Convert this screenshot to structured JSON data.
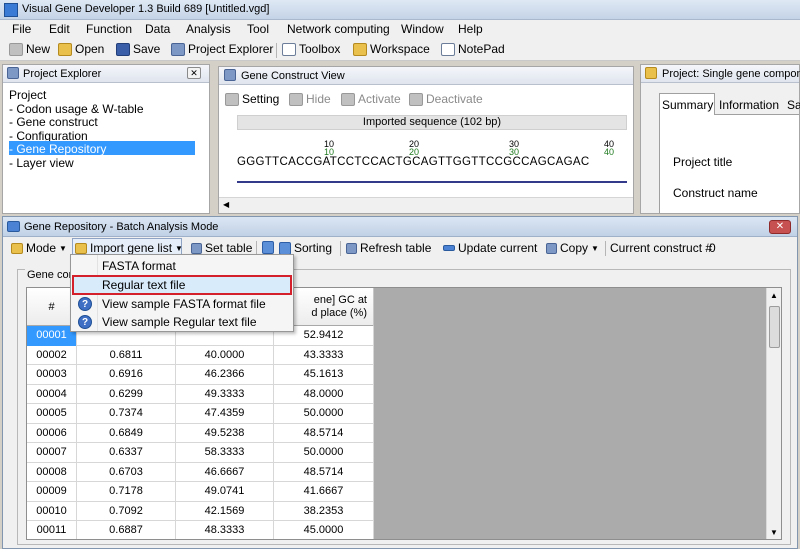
{
  "window": {
    "title": "Visual Gene Developer 1.3  Build 689  [Untitled.vgd]"
  },
  "menu": [
    "File",
    "Edit",
    "Function",
    "Data",
    "Analysis",
    "Tool",
    "Network computing",
    "Window",
    "Help"
  ],
  "toolbar": {
    "new": "New",
    "open": "Open",
    "save": "Save",
    "project_explorer": "Project Explorer",
    "toolbox": "Toolbox",
    "workspace": "Workspace",
    "notepad": "NotePad"
  },
  "project_explorer": {
    "title": "Project Explorer",
    "items": [
      "Project",
      "- Codon usage & W-table",
      "- Gene construct",
      "- Configuration",
      "- Gene Repository",
      "- Layer view"
    ]
  },
  "gene_construct_view": {
    "title": "Gene Construct View",
    "buttons": [
      "Setting",
      "Hide",
      "Activate",
      "Deactivate"
    ],
    "sequence_label": "Imported sequence (102 bp)",
    "ruler_top": [
      "10",
      "20",
      "30",
      "40"
    ],
    "ruler_bottom": [
      "10",
      "20",
      "30",
      "40"
    ],
    "sequence": "GGGTTCACCGATCCTCCACTGCAGTTGGTTCCGCCAGCAGAC"
  },
  "project_panel": {
    "title": "Project:  Single gene componen",
    "tabs": [
      "Summary",
      "Information",
      "Sa"
    ],
    "fields": [
      "Project title",
      "Construct name"
    ]
  },
  "batch": {
    "title": "Gene Repository - Batch Analysis Mode",
    "toolbar": {
      "mode": "Mode",
      "import": "Import gene list",
      "set_table": "Set table",
      "sorting": "Sorting",
      "refresh": "Refresh table",
      "update": "Update current",
      "copy": "Copy",
      "current_label": "Current construct #",
      "current_value": "0"
    },
    "group_label": "Gene con",
    "headers": {
      "num": "#",
      "gc_line1": "ene] GC at",
      "gc_line2": "d place (%)"
    },
    "rows": [
      {
        "id": "00001",
        "v1": "",
        "v2": "",
        "v3": "52.9412"
      },
      {
        "id": "00002",
        "v1": "0.6811",
        "v2": "40.0000",
        "v3": "43.3333"
      },
      {
        "id": "00003",
        "v1": "0.6916",
        "v2": "46.2366",
        "v3": "45.1613"
      },
      {
        "id": "00004",
        "v1": "0.6299",
        "v2": "49.3333",
        "v3": "48.0000"
      },
      {
        "id": "00005",
        "v1": "0.7374",
        "v2": "47.4359",
        "v3": "50.0000"
      },
      {
        "id": "00006",
        "v1": "0.6849",
        "v2": "49.5238",
        "v3": "48.5714"
      },
      {
        "id": "00007",
        "v1": "0.6337",
        "v2": "58.3333",
        "v3": "50.0000"
      },
      {
        "id": "00008",
        "v1": "0.6703",
        "v2": "46.6667",
        "v3": "48.5714"
      },
      {
        "id": "00009",
        "v1": "0.7178",
        "v2": "49.0741",
        "v3": "41.6667"
      },
      {
        "id": "00010",
        "v1": "0.7092",
        "v2": "42.1569",
        "v3": "38.2353"
      },
      {
        "id": "00011",
        "v1": "0.6887",
        "v2": "48.3333",
        "v3": "45.0000"
      }
    ]
  },
  "import_menu": [
    "FASTA format",
    "Regular text file",
    "View sample FASTA format file",
    "View sample Regular text file"
  ]
}
